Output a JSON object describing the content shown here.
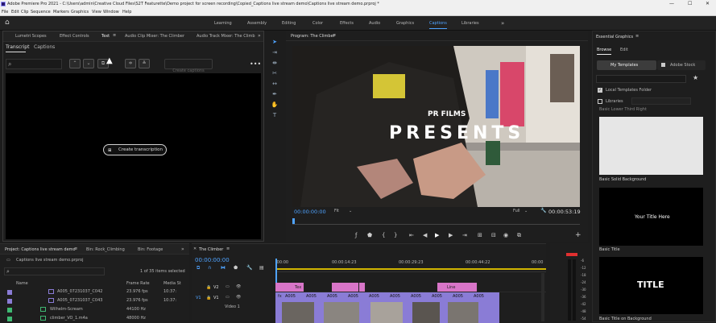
{
  "app": {
    "window_title": "Adobe Premiere Pro 2021 - C:\\Users\\admin\\Creative Cloud Files\\S2T Featurette\\Demo project for screen recording\\Copied_Captions live stream demo\\Captions live stream demo.prproj *",
    "menu": [
      "File",
      "Edit",
      "Clip",
      "Sequence",
      "Markers",
      "Graphics",
      "View",
      "Window",
      "Help"
    ],
    "workspaces": [
      "Learning",
      "Assembly",
      "Editing",
      "Color",
      "Effects",
      "Audio",
      "Graphics",
      "Captions",
      "Libraries"
    ],
    "active_workspace": "Captions",
    "more_label": "»"
  },
  "source_panel": {
    "tabs": [
      "Lumetri Scopes",
      "Effect Controls",
      "Text",
      "Audio Clip Mixer: The Climber",
      "Audio Track Mixer: The Climb"
    ],
    "active_tab": "Text",
    "subtabs": [
      "Transcript",
      "Captions"
    ],
    "search_placeholder": "",
    "create_captions_label": "Create captions",
    "create_transcription_label": "Create transcription"
  },
  "program": {
    "title": "Program: The Climber",
    "overlay_small": "PR FILMS",
    "overlay_big": "PRESENTS",
    "timecode_in": "00:00:00:00",
    "fit": "Fit",
    "quality": "Full",
    "timecode_out": "00:00:53:19",
    "playhead_fraction": 0.0
  },
  "essential_graphics": {
    "title": "Essential Graphics",
    "tabs": [
      "Browse",
      "Edit"
    ],
    "sources": [
      "My Templates",
      "Adobe Stock"
    ],
    "checkboxes": [
      {
        "label": "Local Templates Folder",
        "checked": true
      },
      {
        "label": "Libraries",
        "checked": false
      }
    ],
    "partial_label": "Basic Lower Third Right",
    "templates": [
      {
        "name": "Basic Solid Background",
        "text": ""
      },
      {
        "name": "Basic Title",
        "text": "Your Title Here"
      },
      {
        "name": "Basic Title on Background",
        "text": "TITLE"
      }
    ]
  },
  "project": {
    "tabs": [
      "Project: Captions live stream demo",
      "Bin: Rock_Climbing",
      "Bin: Footage"
    ],
    "file": "Captions live stream demo.prproj",
    "selection": "1 of 35 items selected",
    "columns": [
      "Name",
      "Frame Rate",
      "Media St"
    ],
    "items": [
      {
        "name": "A005_07231037_C042",
        "rate": "23.976 fps",
        "media": "10:37:",
        "color": "#8a7cd6"
      },
      {
        "name": "A005_07231037_C043",
        "rate": "23.976 fps",
        "media": "10:37:",
        "color": "#8a7cd6"
      },
      {
        "name": "Wilhelm-Scream",
        "rate": "44100 Hz",
        "media": "",
        "color": "#3fb872"
      },
      {
        "name": "climber_VO_1.m4a",
        "rate": "48000 Hz",
        "media": "",
        "color": "#3fb872"
      }
    ]
  },
  "timeline": {
    "title": "The Climber",
    "timecode": "00:00:00:00",
    "ruler": [
      ":00:00",
      "00:00:14:23",
      "00:00:29:23",
      "00:00:44:22",
      "00:00"
    ],
    "tracks": [
      "V2",
      "V1"
    ],
    "track_name": "Video 1",
    "clip_labels": [
      "Tex",
      "A005",
      "A005",
      "A005",
      "A005",
      "A005",
      "A005",
      "A005",
      "A005",
      "A005",
      "A005",
      "A005",
      "A005",
      "A005",
      "A005",
      "A005",
      "A005",
      "A005"
    ],
    "fx_labels": [
      "fx",
      "fx",
      "fx",
      "fx",
      "fx",
      "fx",
      "fx",
      "fx",
      "fx"
    ],
    "title_clip_label": "Line"
  },
  "meter": {
    "labels": [
      "-6",
      "-12",
      "-18",
      "-24",
      "-30",
      "-36",
      "-42",
      "-48",
      "-54"
    ]
  },
  "colors": {
    "accent": "#2d8ceb",
    "title_clip": "#d875c8",
    "video_clip": "#8a7cd6",
    "audio_clip": "#3fb872",
    "meter_peak": "#e03030"
  }
}
